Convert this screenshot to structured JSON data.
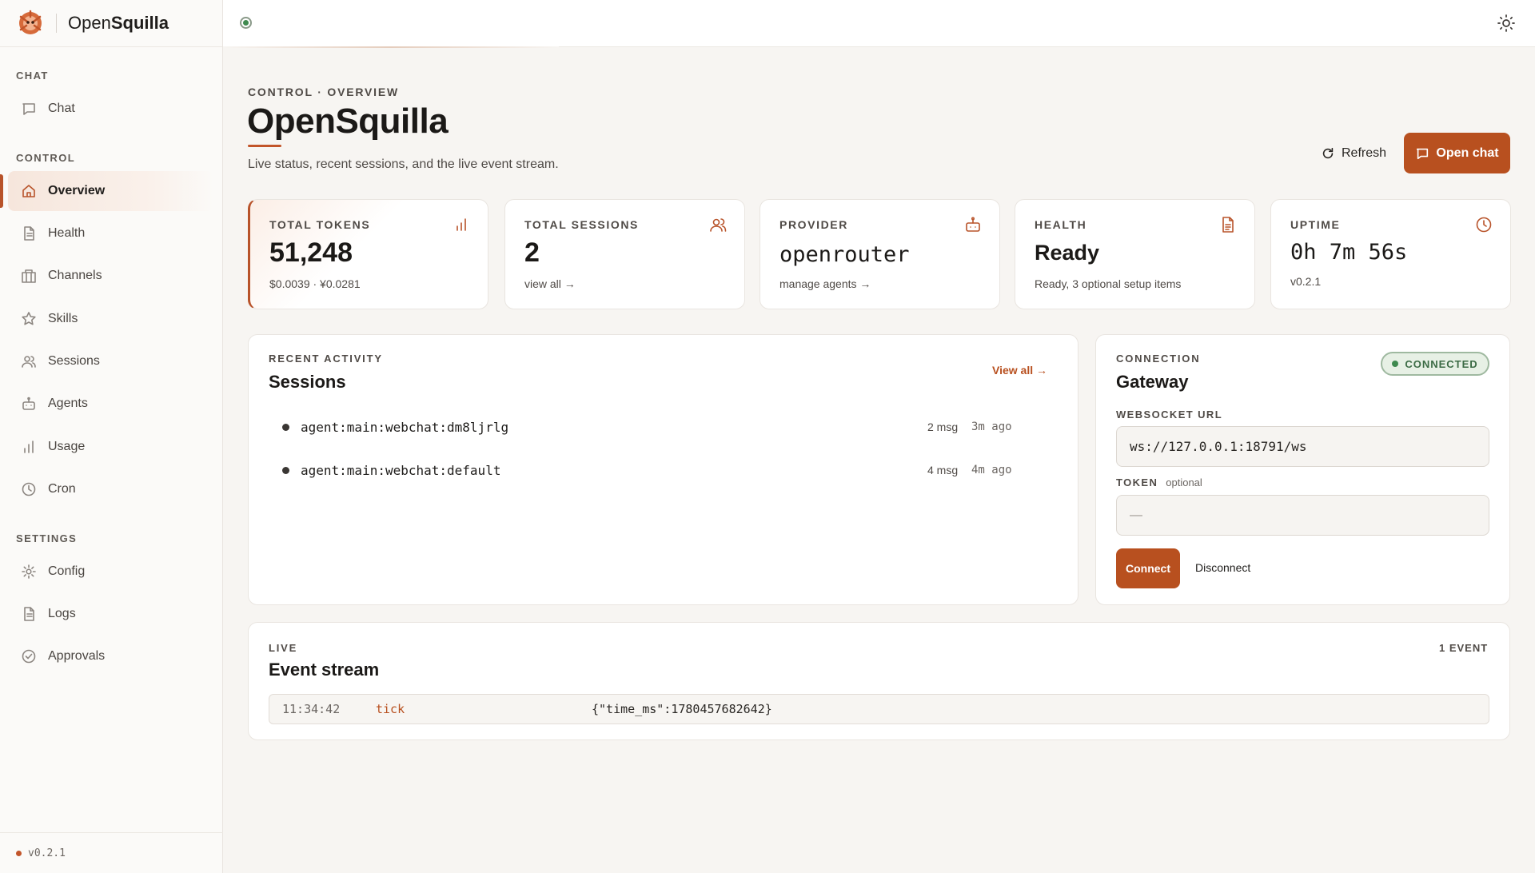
{
  "brand": {
    "name_prefix": "Open",
    "name_bold": "Squilla"
  },
  "sidebar": {
    "sections": {
      "chat": "CHAT",
      "control": "CONTROL",
      "settings": "SETTINGS"
    },
    "items": [
      {
        "label": "Chat",
        "icon": "chat-icon"
      },
      {
        "label": "Overview",
        "icon": "home-icon",
        "active": true
      },
      {
        "label": "Health",
        "icon": "document-icon"
      },
      {
        "label": "Channels",
        "icon": "building-icon"
      },
      {
        "label": "Skills",
        "icon": "star-icon"
      },
      {
        "label": "Sessions",
        "icon": "users-icon"
      },
      {
        "label": "Agents",
        "icon": "bot-icon"
      },
      {
        "label": "Usage",
        "icon": "bar-chart-icon"
      },
      {
        "label": "Cron",
        "icon": "clock-icon"
      },
      {
        "label": "Config",
        "icon": "gear-icon"
      },
      {
        "label": "Logs",
        "icon": "document-icon"
      },
      {
        "label": "Approvals",
        "icon": "check-circle-icon"
      }
    ],
    "footer_version": "v0.2.1"
  },
  "header": {
    "eyebrow": "CONTROL · OVERVIEW",
    "title": "OpenSquilla",
    "subtitle": "Live status, recent sessions, and the live event stream.",
    "refresh_label": "Refresh",
    "open_chat_label": "Open chat"
  },
  "stats": [
    {
      "label": "TOTAL TOKENS",
      "value": "51,248",
      "sub": "$0.0039 · ¥0.0281",
      "icon": "bar-chart-icon"
    },
    {
      "label": "TOTAL SESSIONS",
      "value": "2",
      "sub": "view all →",
      "icon": "users-icon"
    },
    {
      "label": "PROVIDER",
      "value": "openrouter",
      "sub": "manage agents →",
      "icon": "bot-icon"
    },
    {
      "label": "HEALTH",
      "value": "Ready",
      "sub": "Ready, 3 optional setup items",
      "icon": "document-icon"
    },
    {
      "label": "UPTIME",
      "value": "0h 7m 56s",
      "sub": "v0.2.1",
      "icon": "clock-icon"
    }
  ],
  "sessions_card": {
    "eyebrow": "RECENT ACTIVITY",
    "title": "Sessions",
    "view_all": "View all →",
    "rows": [
      {
        "key": "agent:main:webchat:dm8ljrlg",
        "msgs": "2 msg",
        "ago": "3m ago"
      },
      {
        "key": "agent:main:webchat:default",
        "msgs": "4 msg",
        "ago": "4m ago"
      }
    ]
  },
  "connection": {
    "eyebrow": "CONNECTION",
    "title": "Gateway",
    "status": "CONNECTED",
    "ws_label": "WEBSOCKET URL",
    "ws_value": "ws://127.0.0.1:18791/ws",
    "token_label": "TOKEN",
    "token_optional": "optional",
    "token_placeholder": "—",
    "connect_label": "Connect",
    "disconnect_label": "Disconnect"
  },
  "events": {
    "eyebrow": "LIVE",
    "title": "Event stream",
    "count": "1 EVENT",
    "rows": [
      {
        "time": "11:34:42",
        "type": "tick",
        "payload": "{\"time_ms\":1780457682642}"
      }
    ]
  },
  "colors": {
    "accent": "#b8501f",
    "connected": "#3f8a4f",
    "background": "#f7f5f2"
  }
}
